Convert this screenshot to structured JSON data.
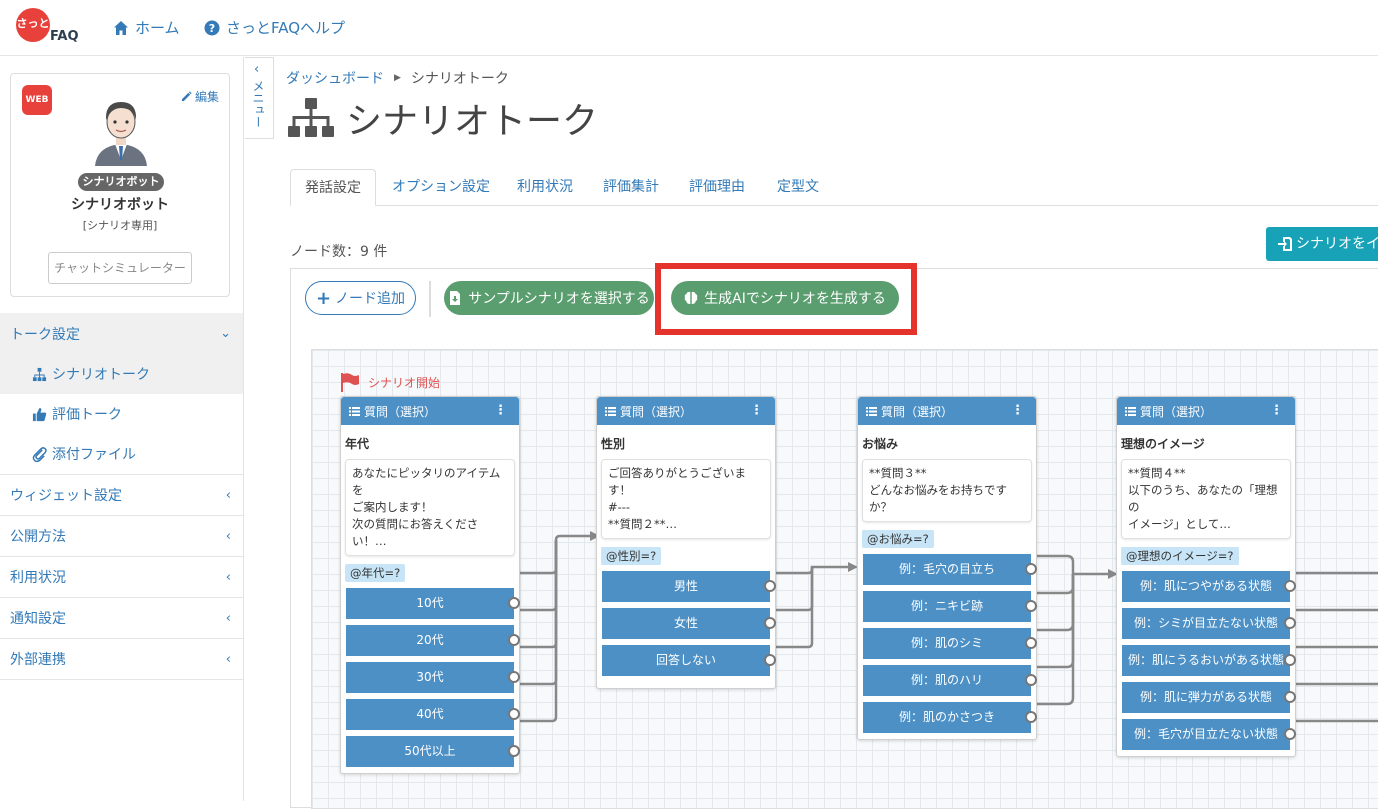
{
  "header": {
    "logo_mark": "さっと",
    "logo_text": "FAQ",
    "home_label": "ホーム",
    "help_label": "さっとFAQヘルプ"
  },
  "profile": {
    "channel_badge": "WEB",
    "edit_label": "編集",
    "role_badge": "シナリオボット",
    "bot_name": "シナリオボット",
    "bot_sub": "[シナリオ専用]",
    "simulator_button": "チャットシミュレーター"
  },
  "menu": {
    "groups": [
      {
        "label": "トーク設定",
        "open": true
      },
      {
        "label": "ウィジェット設定"
      },
      {
        "label": "公開方法"
      },
      {
        "label": "利用状況"
      },
      {
        "label": "通知設定"
      },
      {
        "label": "外部連携"
      }
    ],
    "subitems": [
      {
        "label": "シナリオトーク",
        "icon": "sitemap-icon",
        "active": true
      },
      {
        "label": "評価トーク",
        "icon": "thumbs-up-icon"
      },
      {
        "label": "添付ファイル",
        "icon": "paperclip-icon"
      }
    ],
    "collapse_label": "メニュー"
  },
  "breadcrumb": {
    "root": "ダッシュボード",
    "current": "シナリオトーク"
  },
  "page_title": "シナリオトーク",
  "tabs": [
    "発話設定",
    "オプション設定",
    "利用状況",
    "評価集計",
    "評価理由",
    "定型文"
  ],
  "active_tab": "発話設定",
  "node_count": "ノード数：9 件",
  "import_button": "シナリオをイ",
  "toolbar": {
    "add_node": "ノード追加",
    "sample": "サンプルシナリオを選択する",
    "generate_ai": "生成AIでシナリオを生成する"
  },
  "canvas": {
    "start_label": "シナリオ開始",
    "nodes": [
      {
        "head": "質問（選択）",
        "title": "年代",
        "message": "あなたにピッタリのアイテムを\nご案内します！\n次の質問にお答えください！…",
        "var": "@年代=?",
        "options": [
          "10代",
          "20代",
          "30代",
          "40代",
          "50代以上"
        ]
      },
      {
        "head": "質問（選択）",
        "title": "性別",
        "message": "ご回答ありがとうございます！\n#---\n**質問２**…",
        "var": "@性別=?",
        "options": [
          "男性",
          "女性",
          "回答しない"
        ]
      },
      {
        "head": "質問（選択）",
        "title": "お悩み",
        "message": "**質問３**\nどんなお悩みをお持ちですか？",
        "var": "@お悩み=?",
        "options": [
          "例：毛穴の目立ち",
          "例：ニキビ跡",
          "例：肌のシミ",
          "例：肌のハリ",
          "例：肌のかさつき"
        ]
      },
      {
        "head": "質問（選択）",
        "title": "理想のイメージ",
        "message": "**質問４**\n以下のうち、あなたの「理想の\nイメージ」として…",
        "var": "@理想のイメージ=?",
        "options": [
          "例：肌につやがある状態",
          "例：シミが目立たない状態",
          "例：肌にうるおいがある状態",
          "例：肌に弾力がある状態",
          "例：毛穴が目立たない状態"
        ]
      }
    ]
  },
  "colors": {
    "accent": "#337ab7",
    "node_blue": "#4c90c6",
    "green_button": "#5a9e6f",
    "highlight_red": "#e4332a",
    "teal_button": "#17a2b8"
  }
}
